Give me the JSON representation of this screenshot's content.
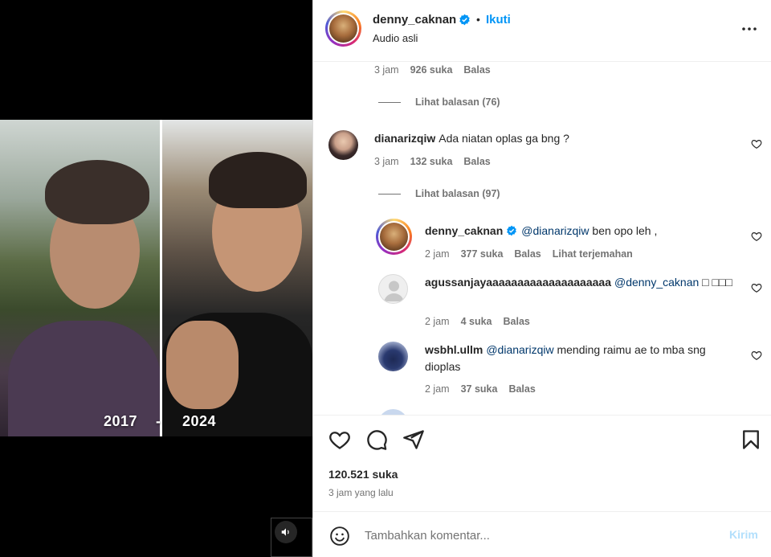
{
  "media": {
    "year_left": "2017",
    "year_sep": "-",
    "year_right": "2024"
  },
  "post": {
    "username": "denny_caknan",
    "bullet": "•",
    "follow_label": "Ikuti",
    "subtitle": "Audio asli"
  },
  "comments": {
    "top_meta": {
      "time": "3 jam",
      "likes": "926 suka",
      "reply": "Balas"
    },
    "top_view_replies": "Lihat balasan (76)",
    "c1": {
      "username": "dianarizqiw",
      "text": "Ada niatan oplas ga bng ?",
      "time": "3 jam",
      "likes": "132 suka",
      "reply": "Balas",
      "view_replies": "Lihat balasan (97)"
    },
    "r1": {
      "username": "denny_caknan",
      "mention": "@dianarizqiw",
      "text": "ben opo leh ,",
      "time": "2 jam",
      "likes": "377 suka",
      "reply": "Balas",
      "translate": "Lihat terjemahan"
    },
    "r2": {
      "username": "agussanjayaaaaaaaaaaaaaaaaaaaa",
      "mention": "@denny_caknan",
      "text": "□ □□□",
      "time": "2 jam",
      "likes": "4 suka",
      "reply": "Balas"
    },
    "r3": {
      "username": "wsbhl.ullm",
      "mention": "@dianarizqiw",
      "text": "mending raimu ae to mba sng dioplas",
      "time": "2 jam",
      "likes": "37 suka",
      "reply": "Balas"
    }
  },
  "actions": {
    "likes": "120.521 suka",
    "time_ago": "3 jam yang lalu"
  },
  "composer": {
    "placeholder": "Tambahkan komentar...",
    "send_label": "Kirim"
  },
  "colors": {
    "link_blue": "#0095f6",
    "muted": "#737373",
    "mention": "#00376b",
    "send_disabled": "#b2dffc"
  },
  "icons": [
    "heart-icon",
    "comment-icon",
    "share-icon",
    "bookmark-icon",
    "more-icon",
    "verified-icon",
    "emoji-icon",
    "speaker-icon"
  ]
}
